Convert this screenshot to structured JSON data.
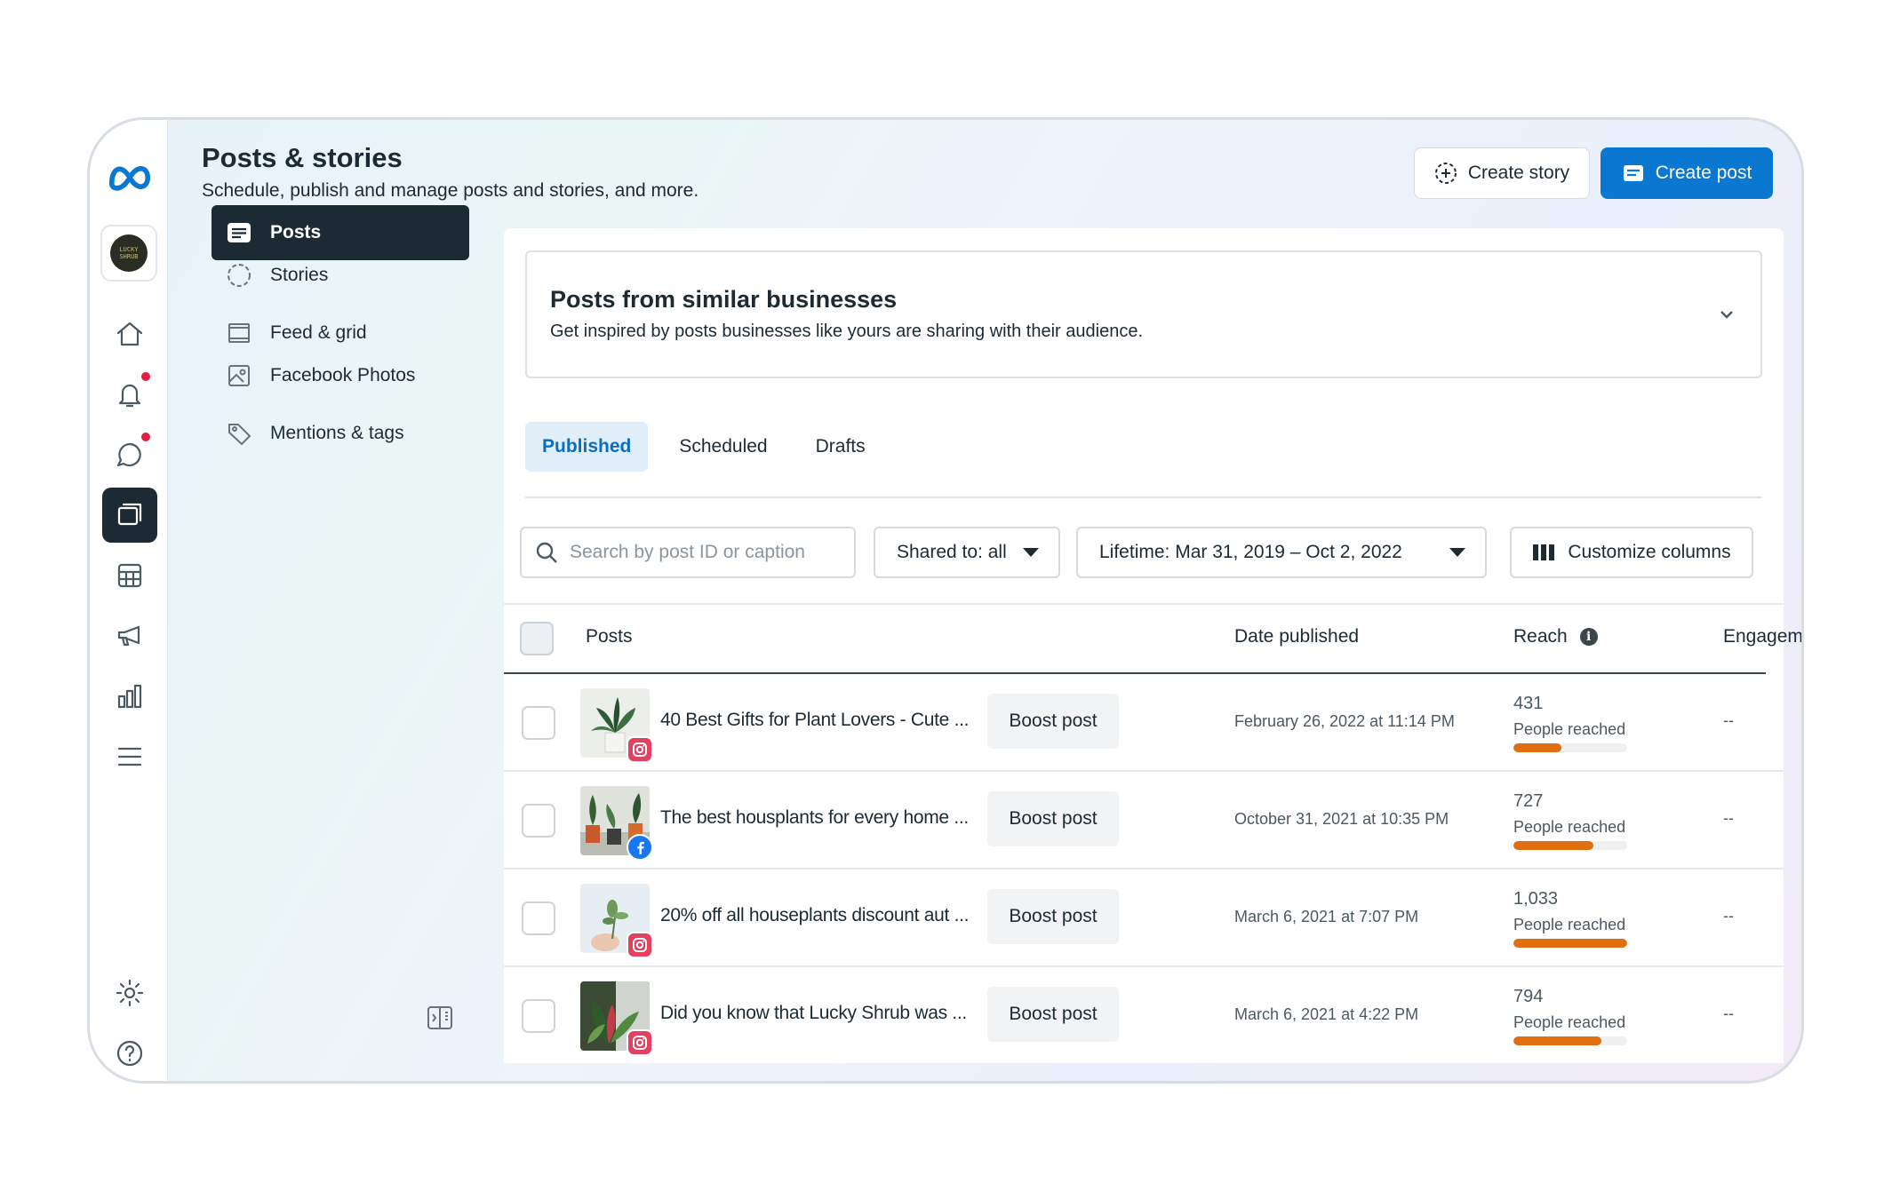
{
  "header": {
    "title": "Posts & stories",
    "subtitle": "Schedule, publish and manage posts and stories, and more.",
    "create_story_label": "Create story",
    "create_post_label": "Create post"
  },
  "rail": {
    "avatar_text": "LUCKY SHRUB",
    "icons": [
      "meta-logo-icon",
      "home-icon",
      "bell-icon",
      "chat-bubble-icon",
      "posts-icon",
      "table-icon",
      "megaphone-icon",
      "bar-chart-icon",
      "menu-icon",
      "gear-icon",
      "help-icon"
    ]
  },
  "subnav": {
    "items": [
      {
        "label": "Posts",
        "icon": "posts-icon",
        "active": true
      },
      {
        "label": "Stories",
        "icon": "stories-icon",
        "active": false
      },
      {
        "label": "Feed & grid",
        "icon": "feed-grid-icon",
        "active": false
      },
      {
        "label": "Facebook Photos",
        "icon": "photos-icon",
        "active": false
      },
      {
        "label": "Mentions & tags",
        "icon": "tag-icon",
        "active": false
      }
    ]
  },
  "similar": {
    "title": "Posts from similar businesses",
    "description": "Get inspired by posts businesses like yours are sharing with their audience."
  },
  "tabs": [
    {
      "label": "Published",
      "active": true
    },
    {
      "label": "Scheduled",
      "active": false
    },
    {
      "label": "Drafts",
      "active": false
    }
  ],
  "filters": {
    "search_placeholder": "Search by post ID or caption",
    "shared_to": "Shared to: all",
    "date_range": "Lifetime: Mar 31, 2019 – Oct 2, 2022",
    "customize_columns": "Customize columns"
  },
  "table": {
    "headers": {
      "posts": "Posts",
      "date": "Date published",
      "reach": "Reach",
      "engagement": "Engagement"
    },
    "rows": [
      {
        "caption": "40 Best Gifts for Plant Lovers - Cute ...",
        "platform": "instagram",
        "boost": "Boost post",
        "date": "February 26, 2022 at 11:14 PM",
        "reach": "431",
        "reach_label": "People reached",
        "reach_fraction": 0.42,
        "engagement": "--"
      },
      {
        "caption": "The best housplants for every home ...",
        "platform": "facebook",
        "boost": "Boost post",
        "date": "October 31, 2021 at 10:35 PM",
        "reach": "727",
        "reach_label": "People reached",
        "reach_fraction": 0.7,
        "engagement": "--"
      },
      {
        "caption": "20% off all houseplants discount aut ...",
        "platform": "instagram",
        "boost": "Boost post",
        "date": "March 6, 2021 at 7:07 PM",
        "reach": "1,033",
        "reach_label": "People reached",
        "reach_fraction": 1.0,
        "engagement": "--"
      },
      {
        "caption": "Did you know that Lucky Shrub was ...",
        "platform": "instagram",
        "boost": "Boost post",
        "date": "March 6, 2021 at 4:22 PM",
        "reach": "794",
        "reach_label": "People reached",
        "reach_fraction": 0.77,
        "engagement": "--"
      }
    ]
  },
  "colors": {
    "accent": "#0a78d1",
    "dark": "#1c2b33",
    "reach_bar": "#e0700f",
    "notification_dot": "#e41e3f"
  }
}
